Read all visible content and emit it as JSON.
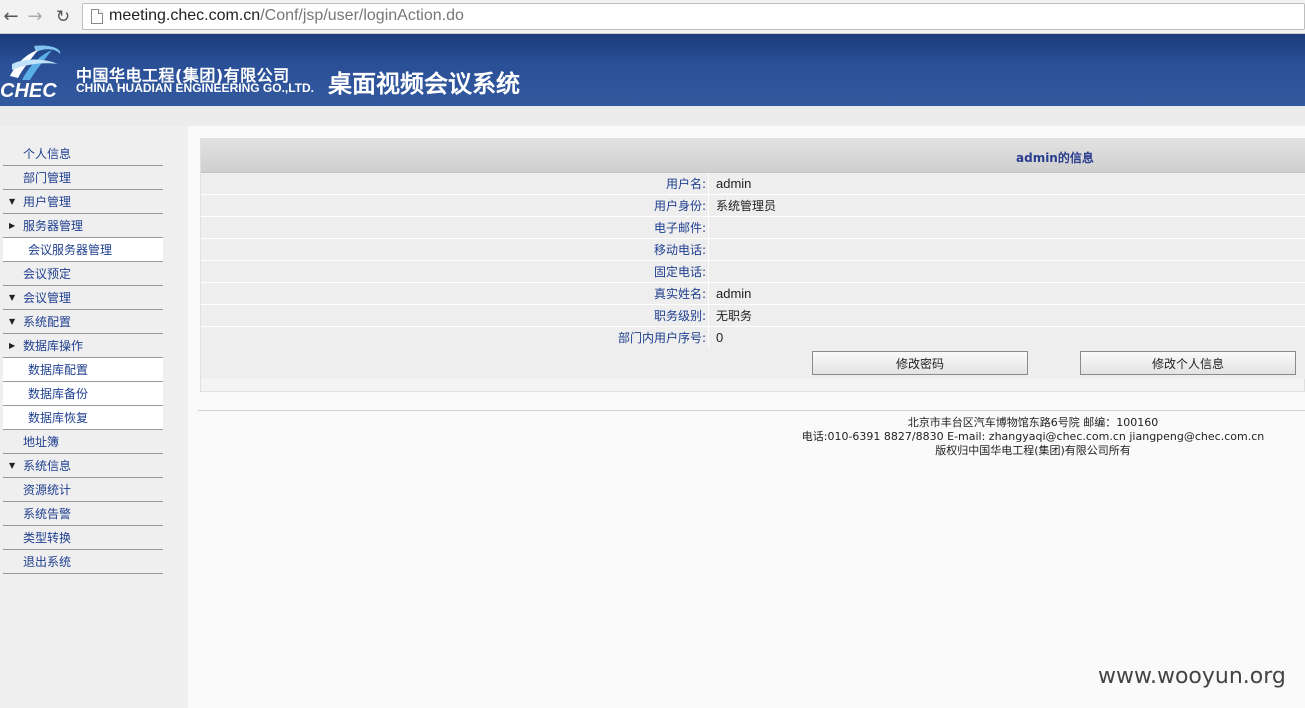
{
  "browser": {
    "url_host": "meeting.chec.com.cn",
    "url_path": "/Conf/jsp/user/loginAction.do"
  },
  "header": {
    "logo_text": "CHEC",
    "company_cn": "中国华电工程(集团)有限公司",
    "company_en": "CHINA HUADIAN ENGINEERING GO.,LTD.",
    "system_title": "桌面视频会议系统",
    "brand_color": "#2a4f96"
  },
  "sidebar": {
    "items": [
      {
        "label": "个人信息",
        "arrow": ""
      },
      {
        "label": "部门管理",
        "arrow": ""
      },
      {
        "label": "用户管理",
        "arrow": "▼"
      },
      {
        "label": "服务器管理",
        "arrow": "▶"
      },
      {
        "label": "会议服务器管理",
        "arrow": ""
      },
      {
        "label": "会议预定",
        "arrow": ""
      },
      {
        "label": "会议管理",
        "arrow": "▼"
      },
      {
        "label": "系统配置",
        "arrow": "▼"
      },
      {
        "label": "数据库操作",
        "arrow": "▶"
      },
      {
        "label": "数据库配置",
        "arrow": ""
      },
      {
        "label": "数据库备份",
        "arrow": ""
      },
      {
        "label": "数据库恢复",
        "arrow": ""
      },
      {
        "label": "地址簿",
        "arrow": ""
      },
      {
        "label": "系统信息",
        "arrow": "▼"
      },
      {
        "label": "资源统计",
        "arrow": ""
      },
      {
        "label": "系统告警",
        "arrow": ""
      },
      {
        "label": "类型转换",
        "arrow": ""
      },
      {
        "label": "退出系统",
        "arrow": ""
      }
    ]
  },
  "info": {
    "title": "admin的信息",
    "rows": [
      {
        "label": "用户名:",
        "value": "admin"
      },
      {
        "label": "用户身份:",
        "value": "系统管理员"
      },
      {
        "label": "电子邮件:",
        "value": ""
      },
      {
        "label": "移动电话:",
        "value": ""
      },
      {
        "label": "固定电话:",
        "value": ""
      },
      {
        "label": "真实姓名:",
        "value": "admin"
      },
      {
        "label": "职务级别:",
        "value": "无职务"
      },
      {
        "label": "部门内用户序号:",
        "value": "0"
      }
    ],
    "change_password_label": "修改密码",
    "edit_profile_label": "修改个人信息"
  },
  "footer": {
    "address": "北京市丰台区汽车博物馆东路6号院 邮编：100160",
    "contact": "电话:010-6391 8827/8830 E-mail: zhangyaqi@chec.com.cn jiangpeng@chec.com.cn",
    "copyright": "版权归中国华电工程(集团)有限公司所有"
  },
  "watermark": "www.wooyun.org"
}
